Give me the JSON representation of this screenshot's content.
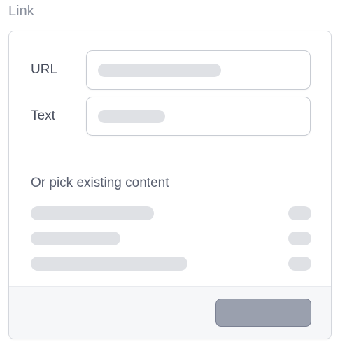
{
  "header": {
    "title": "Link"
  },
  "form": {
    "url": {
      "label": "URL"
    },
    "text": {
      "label": "Text"
    }
  },
  "picker": {
    "title": "Or pick existing content",
    "items": [
      {
        "name": "",
        "meta": ""
      },
      {
        "name": "",
        "meta": ""
      },
      {
        "name": "",
        "meta": ""
      }
    ]
  },
  "footer": {
    "primary_label": ""
  },
  "colors": {
    "border": "#d4d7dd",
    "placeholder": "#dfe1e5",
    "footer_bg": "#f6f7f9",
    "button_bg": "#9aa0ae",
    "button_border": "#7b8193"
  }
}
